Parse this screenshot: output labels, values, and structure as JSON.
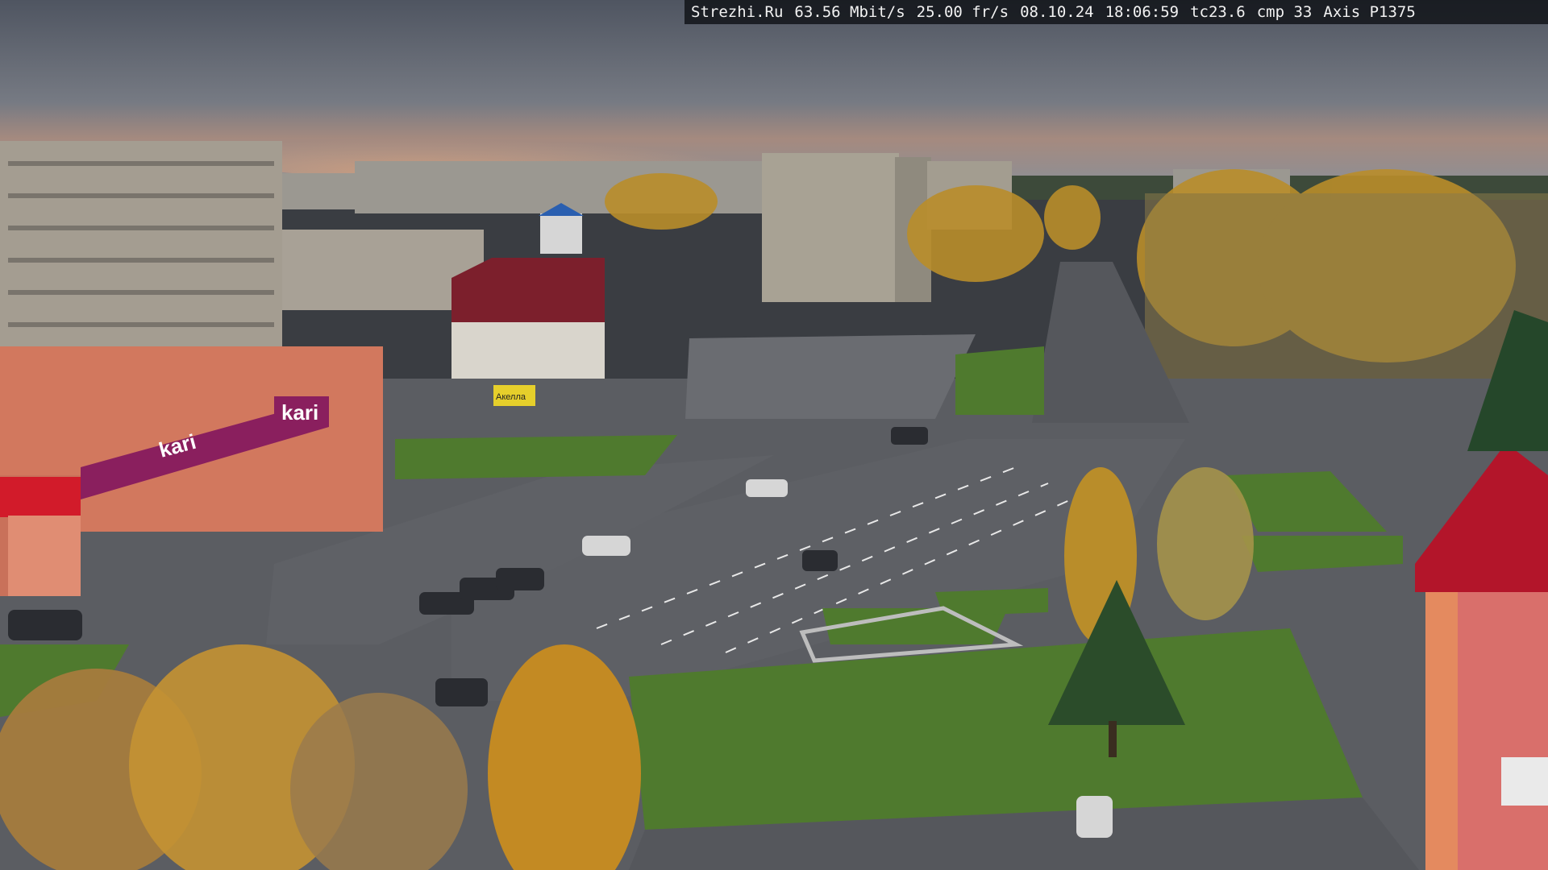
{
  "overlay": {
    "site": "Strezhi.Ru",
    "bitrate": "63.56 Mbit/s",
    "framerate": "25.00 fr/s",
    "date": "08.10.24",
    "time": "18:06:59",
    "tc": "tc23.6",
    "cmp": "cmp 33",
    "camera": "Axis P1375"
  },
  "signs": {
    "store": "kari",
    "store_banner": "kari",
    "billboard": "Акелла"
  },
  "colors": {
    "sky_top": "#5a606c",
    "sky_glow": "#c8957a",
    "asphalt": "#5b5d62",
    "grass": "#4f7a2e",
    "autumn": "#c99a2a",
    "kari_brand": "#8a1f5e",
    "roof_red": "#b3152a"
  }
}
